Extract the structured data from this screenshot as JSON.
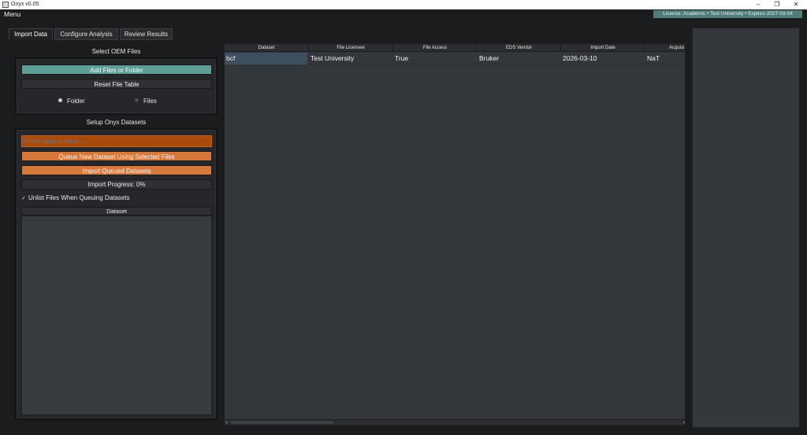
{
  "window": {
    "title": "Onyx v0.05",
    "minimize": "–",
    "restore": "❐",
    "close": "✕"
  },
  "menubar": {
    "menu": "Menu",
    "license": "License: Academic • Test University • Expires 2027-03-04"
  },
  "tabs": [
    {
      "label": "Import Data",
      "active": true
    },
    {
      "label": "Configure Analysis",
      "active": false
    },
    {
      "label": "Review Results",
      "active": false
    }
  ],
  "oem": {
    "title": "Select OEM Files",
    "add_button": "Add Files or Folder",
    "reset_button": "Reset File Table",
    "radio_folder": "Folder",
    "radio_files": "Files",
    "selected_mode": "Folder"
  },
  "datasets": {
    "title": "Setup Onyx Datasets",
    "name_placeholder": "Enter dataset name...",
    "queue_button": "Queue New Dataset Using Selected Files",
    "import_button": "Import Queued Datasets",
    "progress_label": "Import Progress: 0%",
    "progress_value": 0,
    "unlist_checkbox": "Unlist Files When Queuing Datasets",
    "unlist_checked": true,
    "checkmark": "✓",
    "list_header": "Dataset"
  },
  "table": {
    "columns": [
      "Dataset",
      "File Licensee",
      "File Access",
      "EDS Vendor",
      "Import Date",
      "Acquisi"
    ],
    "rows": [
      [
        "bcf",
        "Test University",
        "True",
        "Bruker",
        "2026-03-10",
        "NaT"
      ]
    ],
    "scroll_left": "◂",
    "scroll_right": "▸"
  },
  "colors": {
    "accent_teal": "#5f9e97",
    "accent_orange": "#d6773c",
    "license_bg": "#4f7c78",
    "background": "#1b1c1e"
  }
}
